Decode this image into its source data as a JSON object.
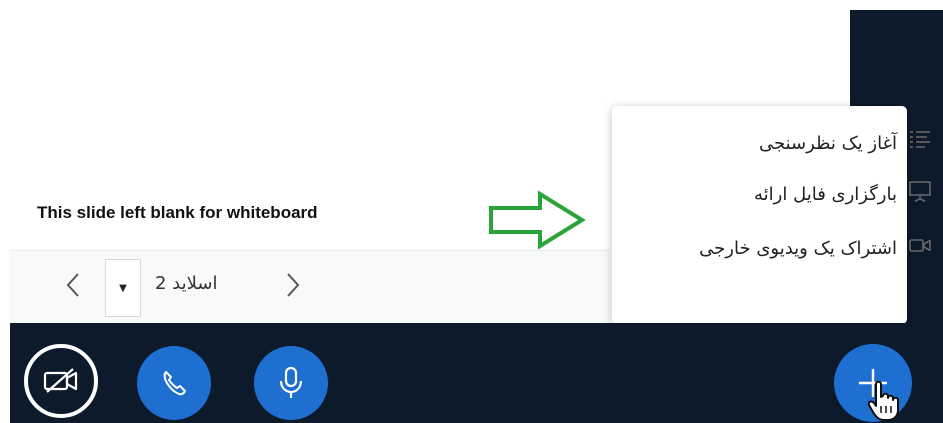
{
  "slide": {
    "blank_text": "This slide left blank for whiteboard",
    "slide_label": "اسلاید 2"
  },
  "actions_menu": {
    "items": [
      {
        "label": "آغاز یک نظرسنجی",
        "icon": "poll-icon"
      },
      {
        "label": "بارگزاری فایل ارائه",
        "icon": "presentation-icon"
      },
      {
        "label": "اشتراک یک ویدیوی خارجی",
        "icon": "external-video-icon"
      }
    ]
  },
  "toolbar": {
    "buttons": [
      "video-off-icon",
      "phone-icon",
      "microphone-icon",
      "plus-icon"
    ]
  },
  "colors": {
    "dark_bg": "#0d1a2b",
    "button_blue": "#1e6fd0",
    "arrow_green": "#2aa43a"
  }
}
